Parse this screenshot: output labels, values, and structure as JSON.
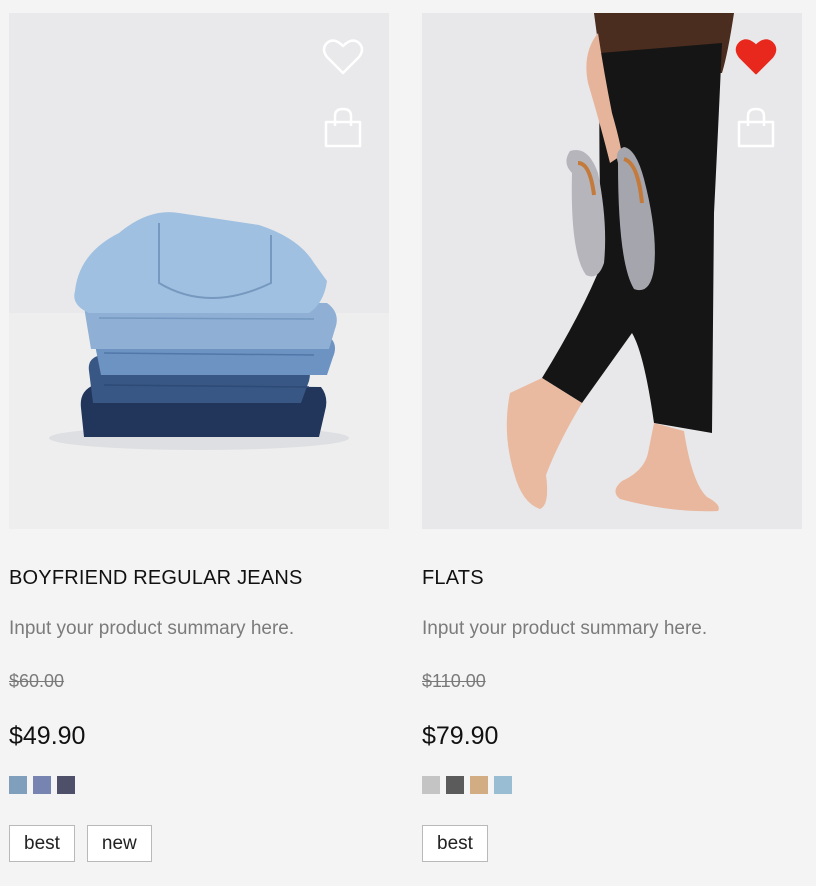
{
  "products": [
    {
      "name": "BOYFRIEND REGULAR JEANS",
      "summary": "Input your product summary here.",
      "original_price": "$60.00",
      "sale_price": "$49.90",
      "wishlisted": false,
      "swatches": [
        "#7f9fbd",
        "#7783b0",
        "#4d5068"
      ],
      "tags": [
        "best",
        "new"
      ]
    },
    {
      "name": "FLATS",
      "summary": "Input your product summary here.",
      "original_price": "$110.00",
      "sale_price": "$79.90",
      "wishlisted": true,
      "swatches": [
        "#c4c4c4",
        "#5b5b5b",
        "#d2ad83",
        "#99bdd3"
      ],
      "tags": [
        "best"
      ]
    }
  ],
  "icons": {
    "wishlist": "heart-icon",
    "cart": "shopping-bag-icon"
  },
  "colors": {
    "wishlist_active": "#e8281d",
    "icon_outline": "#ffffff"
  }
}
